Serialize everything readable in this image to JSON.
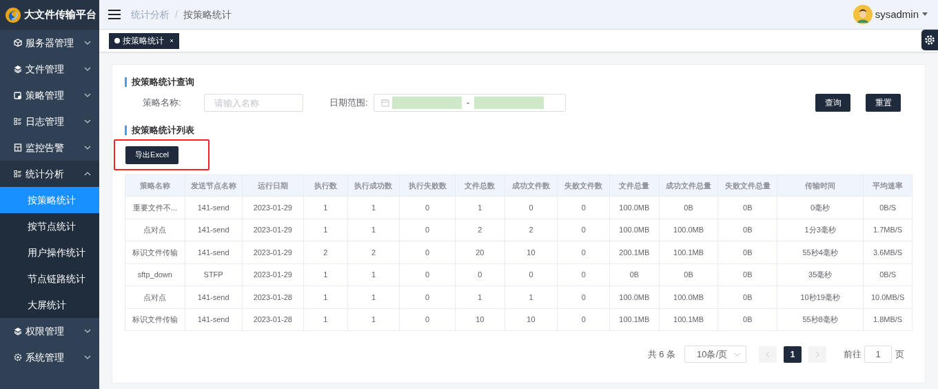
{
  "app": {
    "title": "大文件传输平台"
  },
  "sidebar": {
    "items": [
      {
        "label": "服务器管理",
        "expanded": false
      },
      {
        "label": "文件管理",
        "expanded": false
      },
      {
        "label": "策略管理",
        "expanded": false
      },
      {
        "label": "日志管理",
        "expanded": false
      },
      {
        "label": "监控告警",
        "expanded": false
      },
      {
        "label": "统计分析",
        "expanded": true,
        "children": [
          {
            "label": "按策略统计",
            "selected": true
          },
          {
            "label": "按节点统计",
            "selected": false
          },
          {
            "label": "用户操作统计",
            "selected": false
          },
          {
            "label": "节点链路统计",
            "selected": false
          },
          {
            "label": "大屏统计",
            "selected": false
          }
        ]
      },
      {
        "label": "权限管理",
        "expanded": false
      },
      {
        "label": "系统管理",
        "expanded": false
      }
    ]
  },
  "breadcrumb": {
    "items": [
      "统计分析",
      "按策略统计"
    ],
    "separator": "/"
  },
  "user": {
    "name": "sysadmin"
  },
  "tabs": [
    {
      "label": "按策略统计",
      "selected": true
    }
  ],
  "query": {
    "title": "按策略统计查询",
    "name_label": "策略名称:",
    "name_placeholder": "请输入名称",
    "date_label": "日期范围:",
    "date_separator": "-",
    "buttons": [
      "查询",
      "重置"
    ]
  },
  "list": {
    "title": "按策略统计列表",
    "export_button": {
      "label": "导出Excel",
      "highlighted": true
    }
  },
  "table": {
    "columns": [
      "策略名称",
      "发送节点名称",
      "运行日期",
      "执行数",
      "执行成功数",
      "执行失败数",
      "文件总数",
      "成功文件数",
      "失败文件数",
      "文件总量",
      "成功文件总量",
      "失败文件总量",
      "传输时间",
      "平均速率"
    ],
    "rows": [
      [
        "重要文件不...",
        "141-send",
        "2023-01-29",
        "1",
        "1",
        "0",
        "1",
        "0",
        "0",
        "100.0MB",
        "0B",
        "0B",
        "0毫秒",
        "0B/S"
      ],
      [
        "点对点",
        "141-send",
        "2023-01-29",
        "1",
        "1",
        "0",
        "2",
        "2",
        "0",
        "100.0MB",
        "100.0MB",
        "0B",
        "1分3毫秒",
        "1.7MB/S"
      ],
      [
        "标识文件传输",
        "141-send",
        "2023-01-29",
        "2",
        "2",
        "0",
        "20",
        "10",
        "0",
        "200.1MB",
        "100.1MB",
        "0B",
        "55秒4毫秒",
        "3.6MB/S"
      ],
      [
        "sftp_down",
        "STFP",
        "2023-01-29",
        "1",
        "1",
        "0",
        "0",
        "0",
        "0",
        "0B",
        "0B",
        "0B",
        "35毫秒",
        "0B/S"
      ],
      [
        "点对点",
        "141-send",
        "2023-01-28",
        "1",
        "1",
        "0",
        "1",
        "1",
        "0",
        "100.0MB",
        "100.0MB",
        "0B",
        "10秒19毫秒",
        "10.0MB/S"
      ],
      [
        "标识文件传输",
        "141-send",
        "2023-01-28",
        "1",
        "1",
        "0",
        "10",
        "10",
        "0",
        "100.1MB",
        "100.1MB",
        "0B",
        "55秒8毫秒",
        "1.8MB/S"
      ]
    ]
  },
  "pagination": {
    "total": "共 6 条",
    "page_size": "10条/页",
    "pages": [
      {
        "label": "1",
        "selected": true
      }
    ],
    "goto_label": "前往",
    "goto_value": "1",
    "goto_suffix": "页"
  }
}
